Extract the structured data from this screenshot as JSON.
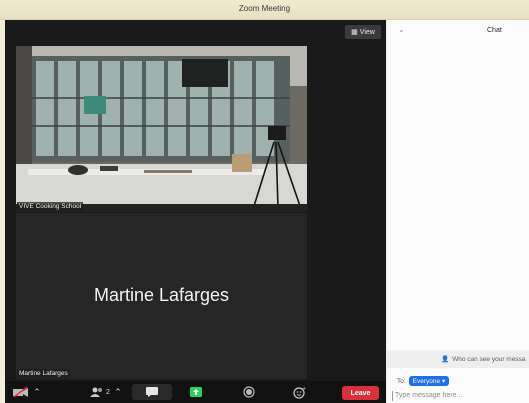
{
  "window": {
    "title": "Zoom Meeting"
  },
  "meeting": {
    "view_label": "View",
    "tiles": [
      {
        "label": "VIVE Cooking School"
      },
      {
        "big_name": "Martine Lafarges",
        "label": "Martine Lafarges"
      }
    ],
    "toolbar": {
      "participants_count": "2",
      "leave_label": "Leave"
    }
  },
  "chat": {
    "title": "Chat",
    "who_can_see": "Who can see your messa",
    "to_label": "To:",
    "recipient": "Everyone",
    "placeholder": "Type message here..."
  },
  "colors": {
    "leave": "#d9303a",
    "recipient": "#1f6fe8",
    "share": "#2ad15a"
  }
}
